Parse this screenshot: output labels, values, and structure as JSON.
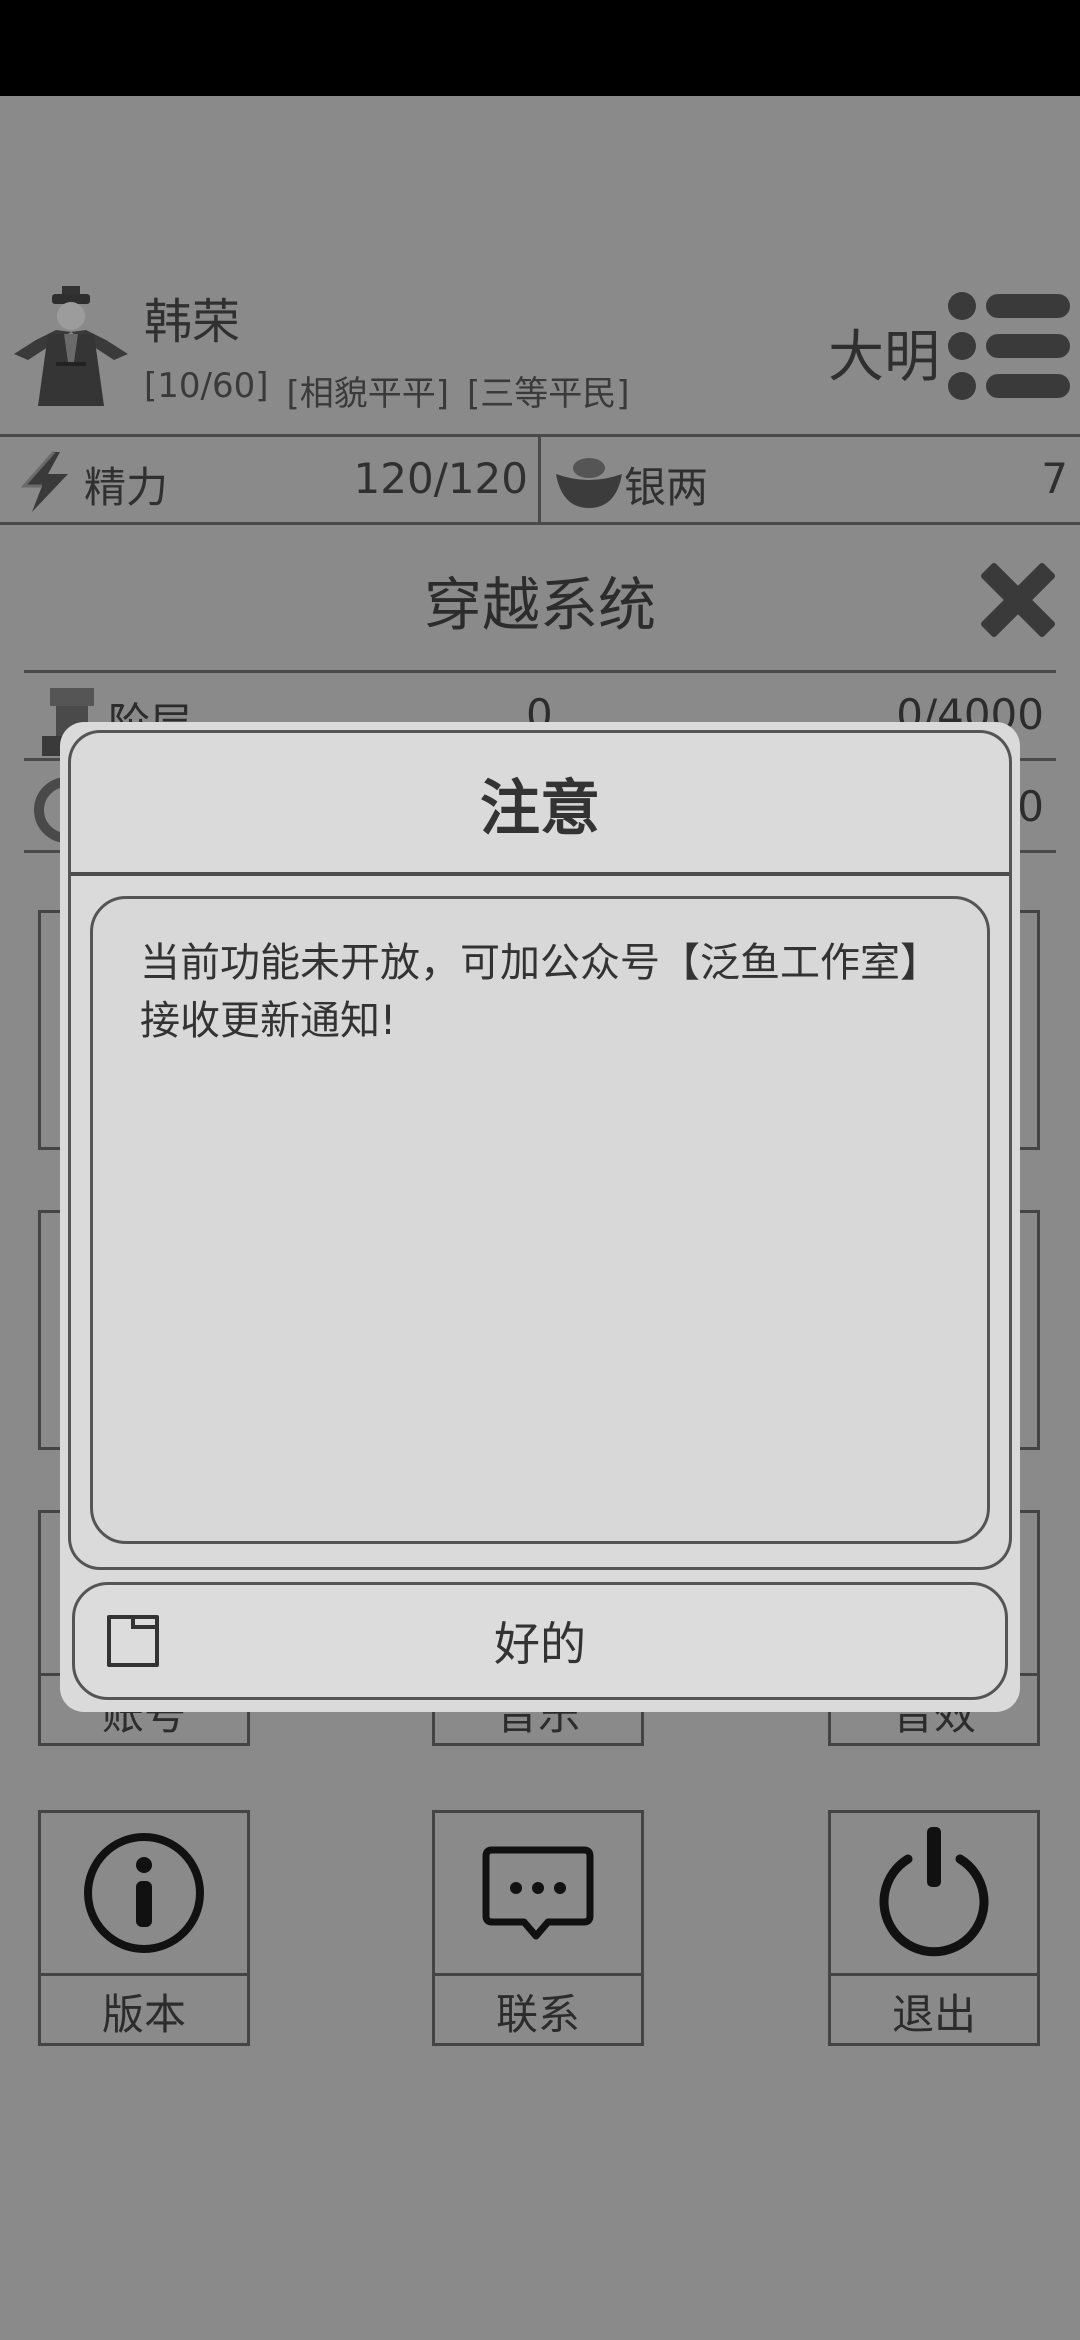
{
  "player": {
    "name": "韩荣",
    "tags": [
      "[10/60]",
      "[相貌平平]",
      "[三等平民]"
    ],
    "dynasty": "大明",
    "avatar_icon": "official-figure-icon",
    "menu_icon": "menu-icon"
  },
  "resources": {
    "energy": {
      "label": "精力",
      "value": "120/120",
      "icon": "lightning-icon"
    },
    "silver": {
      "label": "银两",
      "value": "7",
      "icon": "silver-ingot-icon"
    }
  },
  "panel": {
    "title": "穿越系统",
    "close_icon": "close-icon",
    "rows": [
      {
        "label": "阶层",
        "mid": "0",
        "right": "0/4000",
        "icon": "chess-piece-icon"
      },
      {
        "label": "",
        "mid": "",
        "right": "0",
        "icon": "ring-icon"
      }
    ]
  },
  "hidden_tiles": [
    {
      "label": "账号"
    },
    {
      "label": "音乐"
    },
    {
      "label": "音效"
    }
  ],
  "tiles": [
    {
      "label": "版本",
      "icon": "info-icon"
    },
    {
      "label": "联系",
      "icon": "message-icon"
    },
    {
      "label": "退出",
      "icon": "power-icon"
    }
  ],
  "dialog": {
    "title": "注意",
    "message": "当前功能未开放，可加公众号【泛鱼工作室】接收更新通知!",
    "ok_label": "好的",
    "ok_icon": "folder-icon"
  },
  "colors": {
    "background": "#8a8a8a",
    "dialog": "#dadada",
    "border": "#4a4a4a"
  }
}
